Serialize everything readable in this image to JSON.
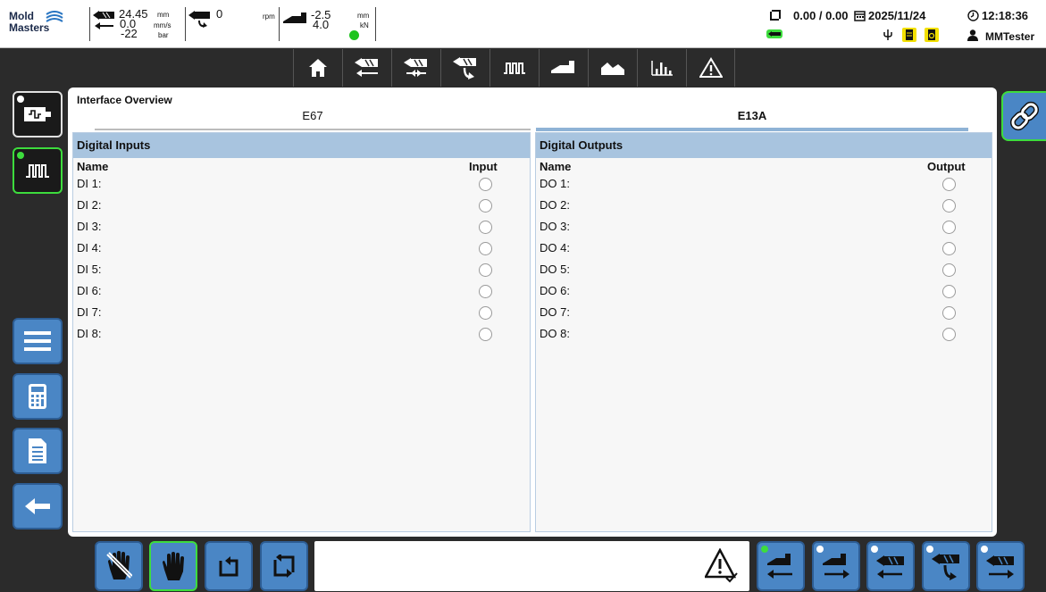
{
  "header": {
    "logo": {
      "line1": "Mold",
      "line2": "Masters"
    },
    "injection": {
      "position": "24.45",
      "position_unit": "mm",
      "speed": "0.0",
      "speed_unit": "mm/s",
      "pressure": "-22",
      "pressure_unit": "bar"
    },
    "screw": {
      "value": "0",
      "unit": "rpm"
    },
    "clamp": {
      "position": "-2.5",
      "position_unit": "mm",
      "force": "4.0",
      "force_unit": "kN"
    },
    "counters": "0.00 / 0.00",
    "date": "2025/11/24",
    "time": "12:18:36",
    "user": "MMTester"
  },
  "topnav": {
    "items": [
      "home-icon",
      "injection-retract-icon",
      "injection-hold-icon",
      "screw-recovery-icon",
      "interface-icon",
      "clamp-icon",
      "profile-icon",
      "statistics-icon",
      "alarm-icon"
    ]
  },
  "page": {
    "title": "Interface Overview",
    "tabs": [
      {
        "label": "E67",
        "active": false
      },
      {
        "label": "E13A",
        "active": true
      }
    ]
  },
  "inputs": {
    "title": "Digital Inputs",
    "col_name": "Name",
    "col_value": "Input",
    "rows": [
      {
        "name": "DI 1:",
        "on": false
      },
      {
        "name": "DI 2:",
        "on": false
      },
      {
        "name": "DI 3:",
        "on": false
      },
      {
        "name": "DI 4:",
        "on": false
      },
      {
        "name": "DI 5:",
        "on": false
      },
      {
        "name": "DI 6:",
        "on": false
      },
      {
        "name": "DI 7:",
        "on": false
      },
      {
        "name": "DI 8:",
        "on": false
      }
    ]
  },
  "outputs": {
    "title": "Digital Outputs",
    "col_name": "Name",
    "col_value": "Output",
    "rows": [
      {
        "name": "DO 1:",
        "on": false
      },
      {
        "name": "DO 2:",
        "on": false
      },
      {
        "name": "DO 3:",
        "on": false
      },
      {
        "name": "DO 4:",
        "on": false
      },
      {
        "name": "DO 5:",
        "on": false
      },
      {
        "name": "DO 6:",
        "on": false
      },
      {
        "name": "DO 7:",
        "on": false
      },
      {
        "name": "DO 8:",
        "on": false
      }
    ]
  },
  "sidebar": {
    "items": [
      "machine-status-icon",
      "interface-icon",
      "menu-icon",
      "calculator-icon",
      "report-icon",
      "back-arrow-icon"
    ]
  },
  "bottombar": {
    "items": [
      "setup-mode-icon",
      "manual-mode-icon",
      "semi-auto-icon",
      "auto-cycle-icon",
      "warning-check-icon",
      "carriage-retract-icon",
      "carriage-forward-icon",
      "injection-retract-icon",
      "screw-recovery-icon",
      "injection-forward-icon"
    ]
  },
  "colors": {
    "accent": "#4a86c5",
    "active_border": "#3ddc3d",
    "panel_header": "#a8c4df",
    "status_ok": "#1ec41e"
  }
}
